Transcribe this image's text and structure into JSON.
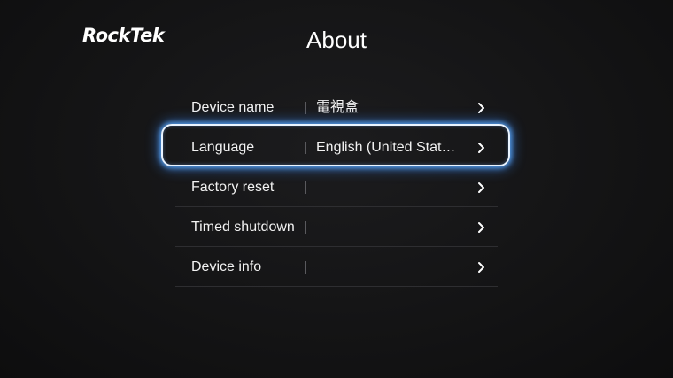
{
  "brand": {
    "logo_text": "RockTek"
  },
  "header": {
    "title": "About"
  },
  "settings": {
    "items": [
      {
        "label": "Device name",
        "value": "電視盒",
        "focused": false
      },
      {
        "label": "Language",
        "value": "English (United Stat…",
        "focused": true
      },
      {
        "label": "Factory reset",
        "value": "",
        "focused": false
      },
      {
        "label": "Timed shutdown",
        "value": "",
        "focused": false
      },
      {
        "label": "Device info",
        "value": "",
        "focused": false
      }
    ],
    "chevron_icon": "chevron-right-icon"
  },
  "colors": {
    "background": "#141415",
    "text": "#f2f2f2",
    "focus_glow": "#5aaaff",
    "divider": "#2e2e31"
  }
}
